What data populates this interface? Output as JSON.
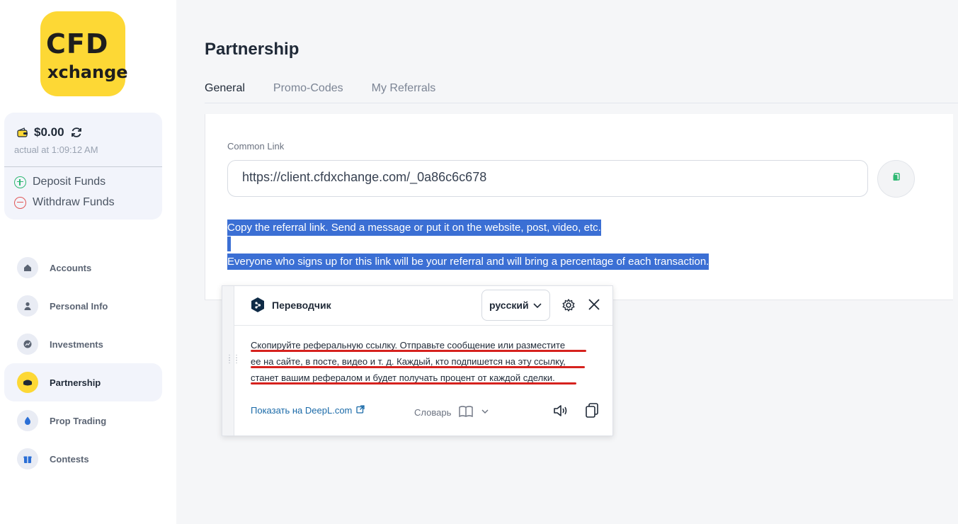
{
  "brand": {
    "line1": "CFD",
    "line2": "xchange",
    "color": "#fdd835"
  },
  "balance": {
    "amount": "$0.00",
    "time": "actual at 1:09:12 AM"
  },
  "funds": {
    "deposit": "Deposit Funds",
    "withdraw": "Withdraw Funds"
  },
  "nav": [
    {
      "label": "Accounts",
      "icon": "home-icon"
    },
    {
      "label": "Personal Info",
      "icon": "user-icon"
    },
    {
      "label": "Investments",
      "icon": "chart-icon"
    },
    {
      "label": "Partnership",
      "icon": "handshake-icon",
      "active": true
    },
    {
      "label": "Prop Trading",
      "icon": "drop-icon"
    },
    {
      "label": "Contests",
      "icon": "gift-icon"
    }
  ],
  "page": {
    "title": "Partnership"
  },
  "tabs": [
    "General",
    "Promo-Codes",
    "My Referrals"
  ],
  "link": {
    "label": "Common Link",
    "value": "https://client.cfdxchange.com/_0a86c6c678"
  },
  "description": {
    "line1": "Copy the referral link. Send a message or put it on the website, post, video, etc.",
    "line2": "Everyone who signs up for this link will be your referral and will bring a percentage of each transaction."
  },
  "translator": {
    "title": "Переводчик",
    "language": "русский",
    "lines": [
      "Скопируйте реферальную ссылку. Отправьте сообщение или разместите",
      "ее на сайте, в посте, видео и т. д. Каждый, кто подпишется на эту ссылку,",
      "станет вашим рефералом и будет получать процент от каждой сделки."
    ],
    "show_link": "Показать на DeepL.com",
    "dictionary": "Словарь"
  },
  "colors": {
    "accent": "#fdd835",
    "selection": "#3b6fd4",
    "underline": "#d6221e",
    "deposit": "#2eb872",
    "withdraw": "#e05656"
  }
}
